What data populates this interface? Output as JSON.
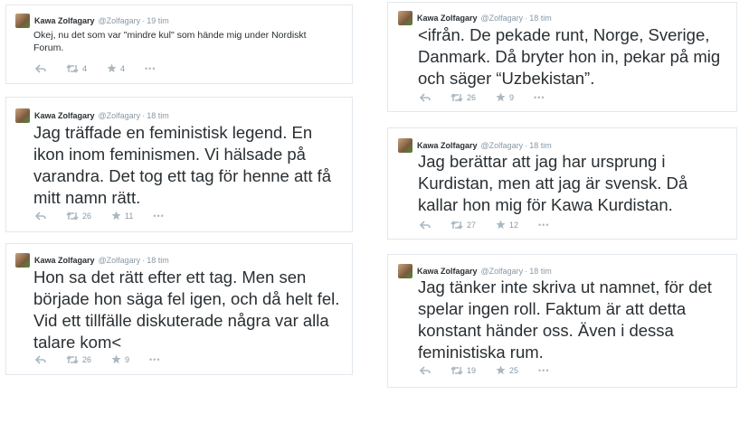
{
  "tweets": [
    {
      "name": "Kawa Zolfagary",
      "handle": "@Zolfagary",
      "time": "19 tim",
      "text": "Okej, nu det som var \"mindre kul\" som hände mig under Nordiskt Forum.",
      "retweets": "4",
      "favorites": "4",
      "more": "•••"
    },
    {
      "name": "Kawa Zolfagary",
      "handle": "@Zolfagary",
      "time": "18 tim",
      "text": "Jag träffade en feministisk legend. En ikon inom feminismen. Vi hälsade på varandra. Det tog ett tag för henne att få mitt namn rätt.",
      "retweets": "26",
      "favorites": "11",
      "more": "•••"
    },
    {
      "name": "Kawa Zolfagary",
      "handle": "@Zolfagary",
      "time": "18 tim",
      "text": "Hon sa det rätt efter ett tag. Men sen började hon säga fel igen, och då helt fel. Vid ett tillfälle diskuterade några var alla talare kom<",
      "retweets": "26",
      "favorites": "9",
      "more": "•••"
    },
    {
      "name": "Kawa Zolfagary",
      "handle": "@Zolfagary",
      "time": "18 tim",
      "text": "<ifrån. De pekade runt, Norge, Sverige, Danmark. Då bryter hon in, pekar på mig och säger “Uzbekistan”.",
      "retweets": "26",
      "favorites": "9",
      "more": "•••"
    },
    {
      "name": "Kawa Zolfagary",
      "handle": "@Zolfagary",
      "time": "18 tim",
      "text": "Jag berättar att jag har ursprung i Kurdistan, men att jag är svensk. Då kallar hon mig för Kawa Kurdistan.",
      "retweets": "27",
      "favorites": "12",
      "more": "•••"
    },
    {
      "name": "Kawa Zolfagary",
      "handle": "@Zolfagary",
      "time": "18 tim",
      "text": "Jag tänker inte skriva ut namnet, för det spelar ingen roll. Faktum är att detta konstant händer oss. Även i dessa feministiska rum.",
      "retweets": "19",
      "favorites": "25",
      "more": "•••"
    }
  ],
  "colors": {
    "text": "#292f33",
    "muted": "#8899a6",
    "border": "#e1e8ed",
    "icon": "#aab8c2"
  }
}
